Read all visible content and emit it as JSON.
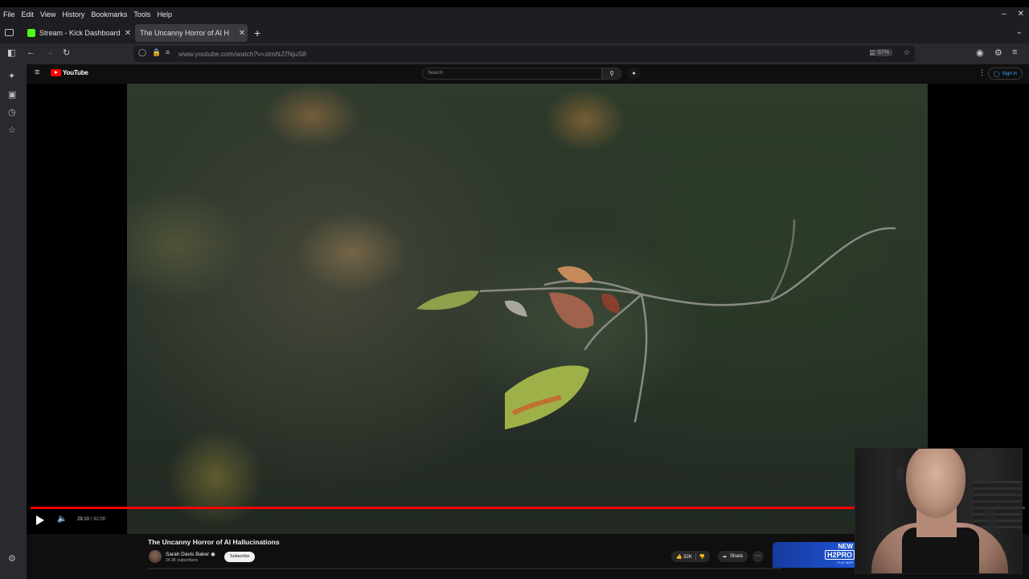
{
  "menu": {
    "items": [
      {
        "label": "File"
      },
      {
        "label": "Edit"
      },
      {
        "label": "View"
      },
      {
        "label": "History"
      },
      {
        "label": "Bookmarks"
      },
      {
        "label": "Tools"
      },
      {
        "label": "Help"
      }
    ]
  },
  "tabs": [
    {
      "title": "Stream - Kick Dashboard"
    },
    {
      "title": "The Uncanny Horror of AI H"
    }
  ],
  "navbar": {
    "url": "www.youtube.com/watch?v=xlmNJ7NjuS8",
    "zoom": "67%"
  },
  "youtube": {
    "logo_text": "YouTube",
    "search_placeholder": "Search",
    "sign_in_label": "Sign in",
    "player": {
      "current_time": "29:10",
      "duration": "32:00",
      "progress": 0.912
    },
    "video_title": "The Uncanny Horror of AI Hallucinations",
    "channel_name": "Sarah Davis Baker",
    "subscribers": "34.3K subscribers",
    "subscribe_label": "Subscribe",
    "likes": "32K",
    "share_label": "Share"
  },
  "ad": {
    "line1": "NEW",
    "brand": "H2PRO",
    "tagline": "FLAT MOP"
  },
  "colors": {
    "progress": "#ff0000",
    "kick_green": "#53fc18",
    "youtube_red": "#ff0000"
  }
}
